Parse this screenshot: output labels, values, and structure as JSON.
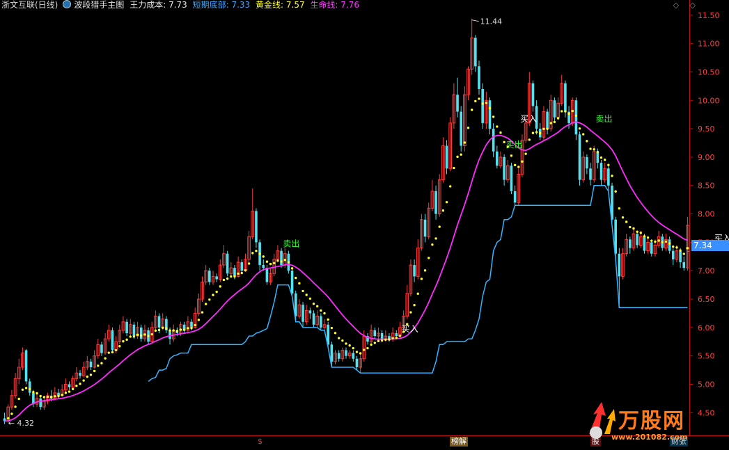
{
  "legend": {
    "title": "浙文互联(日线)",
    "indicator": "波段猎手主图",
    "main_cost_label": "王力成本: 7.73",
    "short_bottom_label": "短期底部: 7.33",
    "gold_line_label": "黄金线: 7.57",
    "life_line_label": "生命线: 7.76"
  },
  "top_icons": [
    "◇",
    "◇"
  ],
  "price_box": "7.34",
  "tags": {
    "s": "$",
    "bang": "榜解",
    "cai": "财张",
    "gu": "股"
  },
  "brand": {
    "text": "万股网",
    "url": "www.201082.com"
  },
  "colors": {
    "up": "#ff3b3b",
    "down": "#54e1f0",
    "axis": "#c01010",
    "life": "#ff2bff",
    "gold": "#ffff33",
    "short": "#33b4ff"
  },
  "chart_data": {
    "type": "candlestick",
    "yticks": [
      "4.50",
      "5.00",
      "5.50",
      "6.00",
      "6.50",
      "7.00",
      "7.50",
      "8.00",
      "8.50",
      "9.00",
      "9.50",
      "10.00",
      "10.50",
      "11.00",
      "11.50"
    ],
    "ylim": [
      4.1,
      11.62
    ],
    "max_label": "11.44",
    "min_label": "4.32",
    "max_price": 11.44,
    "min_price": 4.32,
    "max_index": 130,
    "min_index": 1,
    "last_close": 7.34,
    "signals": [
      {
        "text": "卖出",
        "index": 79,
        "price": 7.35,
        "color": "#33ff33"
      },
      {
        "text": "买入",
        "index": 112,
        "price": 5.85,
        "color": "#ffffff"
      },
      {
        "text": "卖出",
        "index": 141,
        "price": 9.1,
        "color": "#33ff33"
      },
      {
        "text": "买入",
        "index": 145,
        "price": 9.55,
        "color": "#ffffff"
      },
      {
        "text": "卖出",
        "index": 166,
        "price": 9.55,
        "color": "#33ff33"
      },
      {
        "text": "买入",
        "index": 199,
        "price": 7.45,
        "color": "#ffffff"
      }
    ],
    "candles": [
      [
        4.4,
        4.35,
        4.5,
        4.3
      ],
      [
        4.35,
        4.6,
        4.65,
        4.32
      ],
      [
        4.6,
        4.8,
        4.9,
        4.55
      ],
      [
        4.8,
        5.1,
        5.2,
        4.75
      ],
      [
        5.1,
        5.3,
        5.45,
        5.0
      ],
      [
        5.3,
        5.55,
        5.65,
        5.25
      ],
      [
        5.6,
        5.05,
        5.62,
        5.0
      ],
      [
        5.05,
        4.85,
        5.1,
        4.8
      ],
      [
        4.85,
        4.65,
        4.9,
        4.6
      ],
      [
        4.65,
        4.75,
        4.85,
        4.6
      ],
      [
        4.75,
        4.6,
        4.8,
        4.55
      ],
      [
        4.6,
        4.7,
        4.75,
        4.55
      ],
      [
        4.7,
        4.8,
        4.85,
        4.65
      ],
      [
        4.8,
        4.75,
        4.9,
        4.7
      ],
      [
        4.75,
        4.85,
        4.95,
        4.72
      ],
      [
        4.85,
        4.8,
        4.92,
        4.75
      ],
      [
        4.8,
        4.9,
        5.0,
        4.78
      ],
      [
        4.9,
        5.0,
        5.1,
        4.85
      ],
      [
        5.0,
        4.95,
        5.05,
        4.9
      ],
      [
        4.95,
        5.1,
        5.15,
        4.9
      ],
      [
        5.1,
        5.2,
        5.3,
        5.05
      ],
      [
        5.2,
        5.15,
        5.25,
        5.1
      ],
      [
        5.15,
        5.3,
        5.4,
        5.12
      ],
      [
        5.3,
        5.4,
        5.5,
        5.25
      ],
      [
        5.4,
        5.3,
        5.45,
        5.25
      ],
      [
        5.3,
        5.5,
        5.6,
        5.28
      ],
      [
        5.5,
        5.7,
        5.8,
        5.45
      ],
      [
        5.7,
        5.55,
        5.75,
        5.5
      ],
      [
        5.55,
        5.8,
        5.9,
        5.52
      ],
      [
        5.8,
        5.95,
        6.05,
        5.75
      ],
      [
        5.95,
        5.6,
        6.0,
        5.55
      ],
      [
        5.6,
        5.75,
        5.85,
        5.55
      ],
      [
        5.75,
        5.95,
        6.05,
        5.7
      ],
      [
        5.95,
        6.1,
        6.2,
        5.9
      ],
      [
        6.1,
        5.9,
        6.15,
        5.85
      ],
      [
        5.9,
        6.05,
        6.15,
        5.85
      ],
      [
        6.05,
        5.85,
        6.1,
        5.8
      ],
      [
        5.85,
        6.0,
        6.1,
        5.8
      ],
      [
        6.0,
        5.8,
        6.05,
        5.75
      ],
      [
        5.8,
        5.95,
        6.05,
        5.75
      ],
      [
        5.95,
        5.75,
        6.0,
        5.7
      ],
      [
        5.75,
        6.0,
        6.1,
        5.72
      ],
      [
        6.0,
        6.2,
        6.3,
        5.95
      ],
      [
        6.2,
        6.0,
        6.25,
        5.9
      ],
      [
        6.0,
        6.15,
        6.25,
        5.95
      ],
      [
        6.15,
        5.95,
        6.2,
        5.9
      ],
      [
        5.95,
        5.8,
        6.0,
        5.7
      ],
      [
        5.8,
        5.95,
        6.05,
        5.75
      ],
      [
        5.95,
        5.9,
        6.0,
        5.85
      ],
      [
        5.9,
        6.05,
        6.1,
        5.85
      ],
      [
        6.05,
        5.95,
        6.1,
        5.9
      ],
      [
        5.95,
        6.1,
        6.2,
        5.92
      ],
      [
        6.1,
        6.0,
        6.15,
        5.95
      ],
      [
        6.0,
        6.25,
        6.35,
        5.98
      ],
      [
        6.25,
        6.5,
        6.6,
        6.2
      ],
      [
        6.5,
        6.8,
        6.9,
        6.45
      ],
      [
        6.8,
        7.0,
        7.1,
        6.75
      ],
      [
        7.0,
        6.8,
        7.05,
        6.75
      ],
      [
        6.8,
        6.9,
        7.0,
        6.75
      ],
      [
        6.9,
        6.85,
        6.95,
        6.8
      ],
      [
        6.85,
        7.1,
        7.2,
        6.8
      ],
      [
        7.1,
        7.3,
        7.45,
        7.05
      ],
      [
        7.3,
        6.95,
        7.35,
        6.9
      ],
      [
        6.95,
        7.05,
        7.15,
        6.9
      ],
      [
        7.05,
        6.9,
        7.1,
        6.85
      ],
      [
        6.9,
        7.15,
        7.25,
        6.88
      ],
      [
        7.15,
        7.0,
        7.2,
        6.95
      ],
      [
        7.0,
        7.2,
        7.3,
        6.98
      ],
      [
        7.2,
        7.6,
        7.7,
        7.15
      ],
      [
        7.6,
        8.05,
        8.45,
        7.55
      ],
      [
        8.05,
        7.5,
        8.1,
        7.4
      ],
      [
        7.5,
        7.1,
        7.55,
        7.0
      ],
      [
        7.1,
        7.05,
        7.2,
        7.0
      ],
      [
        7.05,
        6.8,
        7.1,
        6.75
      ],
      [
        6.8,
        6.95,
        7.05,
        6.75
      ],
      [
        6.95,
        7.2,
        7.3,
        6.9
      ],
      [
        7.2,
        7.35,
        7.45,
        7.15
      ],
      [
        7.35,
        7.1,
        7.4,
        7.05
      ],
      [
        7.1,
        7.3,
        7.4,
        7.05
      ],
      [
        7.3,
        7.0,
        7.35,
        6.95
      ],
      [
        7.0,
        6.6,
        7.05,
        6.55
      ],
      [
        6.6,
        6.2,
        6.65,
        6.1
      ],
      [
        6.2,
        6.4,
        6.5,
        6.15
      ],
      [
        6.4,
        6.1,
        6.45,
        6.0
      ],
      [
        6.1,
        6.3,
        6.4,
        6.05
      ],
      [
        6.3,
        6.25,
        6.35,
        6.15
      ],
      [
        6.25,
        6.05,
        6.3,
        6.0
      ],
      [
        6.05,
        6.2,
        6.3,
        6.0
      ],
      [
        6.2,
        6.0,
        6.25,
        5.95
      ],
      [
        6.0,
        6.05,
        6.15,
        5.95
      ],
      [
        6.05,
        5.7,
        6.1,
        5.65
      ],
      [
        5.7,
        5.4,
        5.75,
        5.3
      ],
      [
        5.4,
        5.55,
        5.6,
        5.35
      ],
      [
        5.55,
        5.45,
        5.6,
        5.4
      ],
      [
        5.45,
        5.6,
        5.65,
        5.4
      ],
      [
        5.6,
        5.5,
        5.65,
        5.45
      ],
      [
        5.5,
        5.55,
        5.6,
        5.45
      ],
      [
        5.55,
        5.45,
        5.6,
        5.4
      ],
      [
        5.45,
        5.3,
        5.5,
        5.25
      ],
      [
        5.3,
        5.45,
        5.55,
        5.2
      ],
      [
        5.45,
        5.85,
        5.95,
        5.4
      ],
      [
        5.85,
        5.75,
        5.9,
        5.7
      ],
      [
        5.75,
        5.95,
        6.05,
        5.7
      ],
      [
        5.95,
        5.85,
        6.0,
        5.8
      ],
      [
        5.85,
        5.9,
        6.0,
        5.8
      ],
      [
        5.9,
        5.8,
        5.95,
        5.75
      ],
      [
        5.8,
        5.85,
        5.95,
        5.75
      ],
      [
        5.85,
        5.8,
        5.9,
        5.75
      ],
      [
        5.8,
        5.9,
        6.0,
        5.75
      ],
      [
        5.9,
        5.85,
        5.95,
        5.8
      ],
      [
        5.85,
        6.0,
        6.1,
        5.8
      ],
      [
        6.0,
        6.2,
        6.3,
        5.95
      ],
      [
        6.2,
        6.6,
        6.75,
        6.15
      ],
      [
        6.6,
        7.1,
        7.2,
        6.55
      ],
      [
        7.1,
        6.9,
        7.2,
        6.8
      ],
      [
        6.9,
        7.4,
        7.55,
        6.85
      ],
      [
        7.4,
        7.9,
        8.0,
        7.35
      ],
      [
        7.9,
        7.6,
        8.0,
        7.5
      ],
      [
        7.6,
        8.1,
        8.2,
        7.55
      ],
      [
        8.1,
        8.4,
        8.6,
        8.05
      ],
      [
        8.4,
        8.0,
        8.5,
        7.9
      ],
      [
        8.0,
        8.6,
        8.7,
        7.95
      ],
      [
        8.6,
        9.2,
        9.35,
        8.55
      ],
      [
        9.2,
        8.8,
        9.3,
        8.7
      ],
      [
        8.8,
        9.6,
        9.7,
        8.75
      ],
      [
        9.6,
        10.1,
        10.3,
        9.5
      ],
      [
        10.1,
        9.8,
        10.4,
        9.7
      ],
      [
        9.8,
        9.2,
        9.9,
        9.1
      ],
      [
        9.2,
        10.1,
        10.25,
        9.1
      ],
      [
        10.1,
        10.55,
        10.6,
        10.0
      ],
      [
        10.55,
        11.1,
        11.44,
        10.45
      ],
      [
        11.1,
        10.6,
        11.15,
        10.5
      ],
      [
        10.6,
        10.2,
        10.7,
        10.1
      ],
      [
        10.2,
        9.6,
        10.3,
        9.5
      ],
      [
        9.6,
        10.0,
        10.15,
        9.5
      ],
      [
        10.0,
        9.5,
        10.05,
        9.4
      ],
      [
        9.5,
        9.1,
        9.6,
        9.0
      ],
      [
        9.1,
        8.85,
        9.2,
        8.8
      ],
      [
        8.85,
        9.0,
        9.1,
        8.8
      ],
      [
        9.0,
        8.6,
        9.05,
        8.5
      ],
      [
        8.6,
        8.85,
        8.95,
        8.55
      ],
      [
        8.85,
        8.4,
        8.9,
        8.35
      ],
      [
        8.4,
        8.2,
        8.5,
        8.15
      ],
      [
        8.2,
        8.7,
        8.8,
        8.15
      ],
      [
        8.7,
        9.3,
        9.4,
        8.65
      ],
      [
        9.3,
        9.6,
        9.7,
        9.25
      ],
      [
        9.6,
        10.3,
        10.5,
        9.55
      ],
      [
        10.3,
        9.9,
        10.35,
        9.8
      ],
      [
        9.9,
        9.5,
        10.0,
        9.4
      ],
      [
        9.5,
        9.35,
        9.6,
        9.3
      ],
      [
        9.35,
        9.8,
        9.9,
        9.3
      ],
      [
        9.8,
        9.5,
        9.85,
        9.4
      ],
      [
        9.5,
        10.0,
        10.1,
        9.45
      ],
      [
        10.0,
        9.7,
        10.05,
        9.6
      ],
      [
        9.7,
        9.95,
        10.05,
        9.65
      ],
      [
        9.95,
        10.3,
        10.45,
        9.9
      ],
      [
        10.3,
        9.8,
        10.35,
        9.7
      ],
      [
        9.8,
        9.6,
        9.9,
        9.5
      ],
      [
        9.6,
        10.0,
        10.05,
        9.55
      ],
      [
        10.0,
        9.4,
        10.05,
        9.3
      ],
      [
        9.4,
        8.6,
        9.45,
        8.5
      ],
      [
        8.6,
        9.0,
        9.1,
        8.55
      ],
      [
        9.0,
        8.8,
        9.05,
        8.7
      ],
      [
        8.8,
        8.6,
        8.9,
        8.5
      ],
      [
        8.6,
        9.1,
        9.2,
        8.55
      ],
      [
        9.1,
        8.9,
        9.15,
        8.8
      ],
      [
        8.9,
        8.6,
        8.95,
        8.5
      ],
      [
        8.6,
        8.8,
        8.9,
        8.55
      ],
      [
        8.8,
        8.5,
        8.85,
        8.4
      ],
      [
        8.5,
        7.9,
        8.55,
        7.8
      ],
      [
        7.9,
        7.3,
        7.95,
        7.2
      ],
      [
        7.3,
        6.9,
        7.4,
        6.35
      ],
      [
        6.9,
        7.3,
        7.4,
        6.85
      ],
      [
        7.3,
        7.55,
        7.65,
        7.25
      ],
      [
        7.55,
        7.4,
        7.6,
        7.3
      ],
      [
        7.4,
        7.65,
        7.75,
        7.35
      ],
      [
        7.65,
        7.45,
        7.7,
        7.4
      ],
      [
        7.45,
        7.6,
        7.7,
        7.4
      ],
      [
        7.6,
        7.35,
        7.65,
        7.3
      ],
      [
        7.35,
        7.5,
        7.6,
        7.3
      ],
      [
        7.5,
        7.3,
        7.55,
        7.25
      ],
      [
        7.3,
        7.45,
        7.55,
        7.25
      ],
      [
        7.45,
        7.6,
        7.7,
        7.4
      ],
      [
        7.6,
        7.4,
        7.65,
        7.35
      ],
      [
        7.4,
        7.55,
        7.65,
        7.35
      ],
      [
        7.55,
        7.35,
        7.6,
        7.3
      ],
      [
        7.35,
        7.2,
        7.4,
        7.1
      ],
      [
        7.2,
        7.35,
        7.45,
        7.15
      ],
      [
        7.35,
        7.15,
        7.4,
        7.05
      ],
      [
        7.15,
        7.05,
        7.25,
        7.0
      ],
      [
        7.05,
        7.8,
        7.95,
        7.0
      ]
    ]
  }
}
